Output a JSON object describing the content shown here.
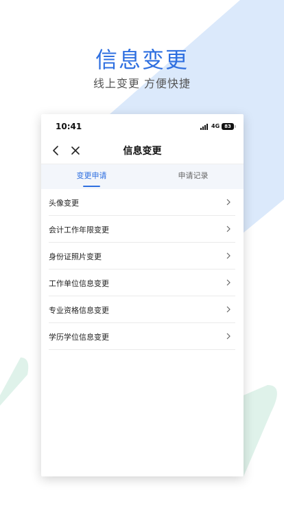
{
  "promo": {
    "title": "信息变更",
    "subtitle": "线上变更  方便快捷"
  },
  "status_bar": {
    "time": "10:41",
    "network": "4G",
    "battery": "83"
  },
  "header": {
    "title": "信息变更"
  },
  "tabs": [
    {
      "label": "变更申请",
      "active": true
    },
    {
      "label": "申请记录",
      "active": false
    }
  ],
  "menu": {
    "items": [
      {
        "label": "头像变更"
      },
      {
        "label": "会计工作年限变更"
      },
      {
        "label": "身份证照片变更"
      },
      {
        "label": "工作单位信息变更"
      },
      {
        "label": "专业资格信息变更"
      },
      {
        "label": "学历学位信息变更"
      }
    ]
  },
  "colors": {
    "accent": "#2e6fe0",
    "decor_blue": "#dbe9fb",
    "decor_green": "#dff2ea"
  }
}
